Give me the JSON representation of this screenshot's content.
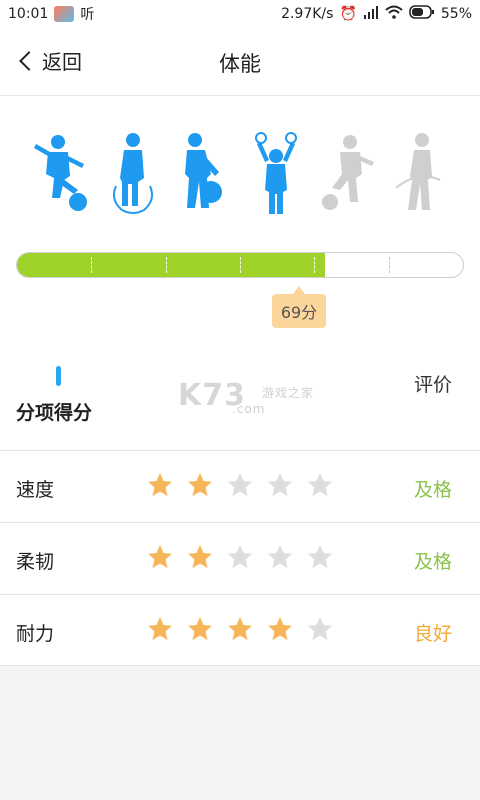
{
  "status_bar": {
    "time": "10:01",
    "listen_label": "听",
    "speed": "2.97K/s",
    "battery": "55%",
    "icons": [
      "app-icon",
      "alarm-icon",
      "signal-icon",
      "wifi-icon",
      "battery-icon"
    ]
  },
  "nav": {
    "back_label": "返回",
    "title": "体能"
  },
  "figures": [
    {
      "name": "kick-ball",
      "active": true
    },
    {
      "name": "jump-rope",
      "active": true
    },
    {
      "name": "ball-bounce",
      "active": true
    },
    {
      "name": "rings",
      "active": true
    },
    {
      "name": "soccer",
      "active": false
    },
    {
      "name": "hula",
      "active": false
    }
  ],
  "progress": {
    "value": 0.69,
    "score_label": "69分",
    "segments": 6
  },
  "section": {
    "title": "分项得分",
    "eval_header": "评价"
  },
  "watermark": {
    "main": "K73",
    "sub": "游戏之家",
    "domain": ".com"
  },
  "rows": [
    {
      "name": "速度",
      "stars": 2,
      "grade": "及格",
      "grade_color": "#8bc34a"
    },
    {
      "name": "柔韧",
      "stars": 2,
      "grade": "及格",
      "grade_color": "#8bc34a"
    },
    {
      "name": "耐力",
      "stars": 4,
      "grade": "良好",
      "grade_color": "#f2a93b"
    }
  ],
  "colors": {
    "active_figure": "#1e9af0",
    "inactive_figure": "#cfcfcf",
    "progress_fill": "#9fd229",
    "star_on": "#f6b65a",
    "star_off": "#dedede"
  }
}
